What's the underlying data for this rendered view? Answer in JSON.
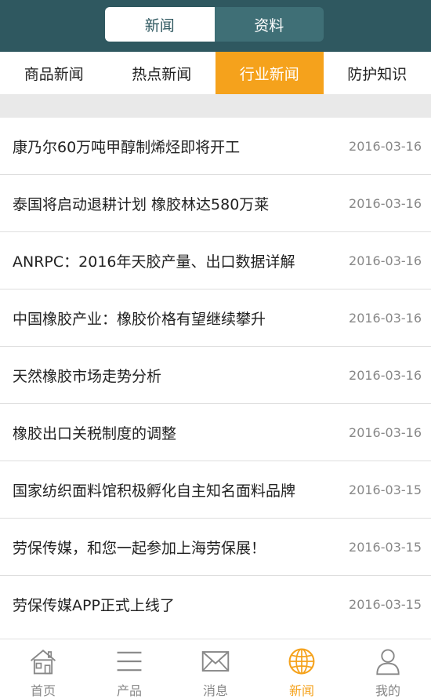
{
  "header": {
    "segments": [
      {
        "label": "新闻",
        "active": true
      },
      {
        "label": "资料",
        "active": false
      }
    ]
  },
  "tabs": [
    {
      "label": "商品新闻",
      "active": false
    },
    {
      "label": "热点新闻",
      "active": false
    },
    {
      "label": "行业新闻",
      "active": true
    },
    {
      "label": "防护知识",
      "active": false
    }
  ],
  "news": [
    {
      "title": "康乃尔60万吨甲醇制烯烃即将开工",
      "date": "2016-03-16"
    },
    {
      "title": "泰国将启动退耕计划 橡胶林达580万莱",
      "date": "2016-03-16"
    },
    {
      "title": "ANRPC：2016年天胶产量、出口数据详解",
      "date": "2016-03-16"
    },
    {
      "title": "中国橡胶产业：橡胶价格有望继续攀升",
      "date": "2016-03-16"
    },
    {
      "title": "天然橡胶市场走势分析",
      "date": "2016-03-16"
    },
    {
      "title": "橡胶出口关税制度的调整",
      "date": "2016-03-16"
    },
    {
      "title": "国家纺织面料馆积极孵化自主知名面料品牌",
      "date": "2016-03-15"
    },
    {
      "title": "劳保传媒，和您一起参加上海劳保展！",
      "date": "2016-03-15"
    },
    {
      "title": "劳保传媒APP正式上线了",
      "date": "2016-03-15"
    }
  ],
  "bottom_nav": [
    {
      "label": "首页",
      "icon": "home-icon",
      "active": false
    },
    {
      "label": "产品",
      "icon": "menu-icon",
      "active": false
    },
    {
      "label": "消息",
      "icon": "mail-icon",
      "active": false
    },
    {
      "label": "新闻",
      "icon": "globe-icon",
      "active": true
    },
    {
      "label": "我的",
      "icon": "user-icon",
      "active": false
    }
  ],
  "colors": {
    "header_bg": "#2f5860",
    "accent": "#f5a21c",
    "text": "#222222",
    "muted": "#888888"
  }
}
